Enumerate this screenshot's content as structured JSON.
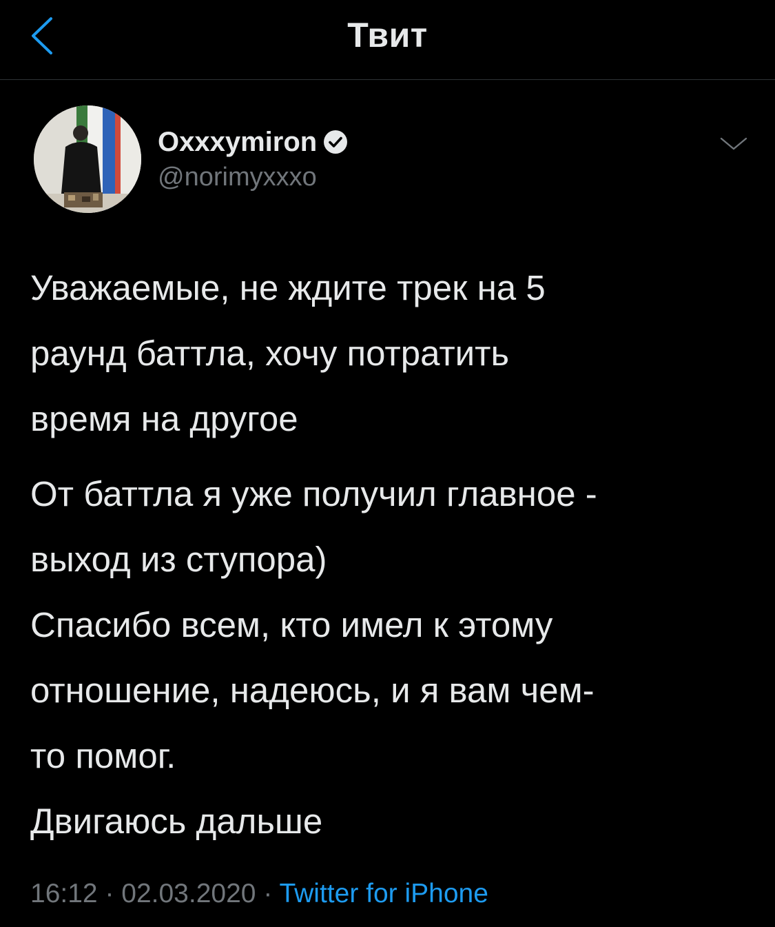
{
  "nav": {
    "title": "Твит",
    "back_icon": "chevron-left-icon"
  },
  "author": {
    "display_name": "Oxxxymiron",
    "handle": "@norimyxxxo",
    "verified": true
  },
  "tweet": {
    "paragraphs": [
      "Уважаемые, не ждите трек на 5\nраунд баттла, хочу потратить\nвремя на другое",
      "От баттла я уже получил главное -\nвыход из ступора)\nСпасибо всем, кто имел к этому\nотношение, надеюсь, и я вам чем-\nто помог.\nДвигаюсь дальше"
    ],
    "time": "16:12",
    "separator": " · ",
    "date": "02.03.2020",
    "source": "Twitter for iPhone"
  },
  "colors": {
    "background": "#000000",
    "text": "#e7e9ea",
    "secondary": "#71767b",
    "accent": "#1d9bf0"
  }
}
